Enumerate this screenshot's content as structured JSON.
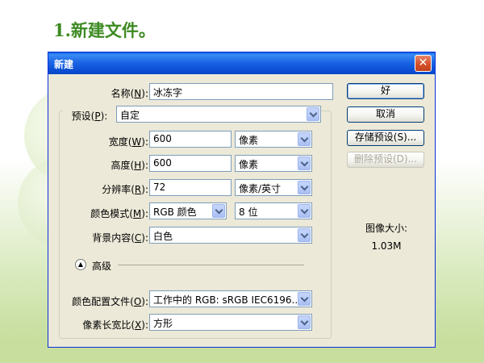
{
  "slide": {
    "title": "1.新建文件。"
  },
  "dialog": {
    "title": "新建",
    "close_icon": "close-icon",
    "name": {
      "label": "名称(",
      "key": "N",
      "suffix": "):",
      "value": "冰冻字"
    },
    "preset": {
      "label": "预设(",
      "key": "P",
      "suffix": "):",
      "value": "自定"
    },
    "width": {
      "label": "宽度(",
      "key": "W",
      "suffix": "):",
      "value": "600",
      "unit": "像素"
    },
    "height": {
      "label": "高度(",
      "key": "H",
      "suffix": "):",
      "value": "600",
      "unit": "像素"
    },
    "resolution": {
      "label": "分辨率(",
      "key": "R",
      "suffix": "):",
      "value": "72",
      "unit": "像素/英寸"
    },
    "color_mode": {
      "label": "颜色模式(",
      "key": "M",
      "suffix": "):",
      "value": "RGB 颜色",
      "depth": "8 位"
    },
    "background": {
      "label": "背景内容(",
      "key": "C",
      "suffix": "):",
      "value": "白色"
    },
    "advanced": {
      "label": "高级",
      "icon": "chevron-up-icon"
    },
    "color_profile": {
      "label": "颜色配置文件(",
      "key": "O",
      "suffix": "):",
      "value": "工作中的 RGB: sRGB IEC6196..."
    },
    "pixel_aspect": {
      "label": "像素长宽比(",
      "key": "X",
      "suffix": "):",
      "value": "方形"
    },
    "buttons": {
      "ok": "好",
      "cancel": "取消",
      "save_preset": "存储预设(S)...",
      "delete_preset": "删除预设(D)..."
    },
    "image_size": {
      "label": "图像大小:",
      "value": "1.03M"
    }
  }
}
